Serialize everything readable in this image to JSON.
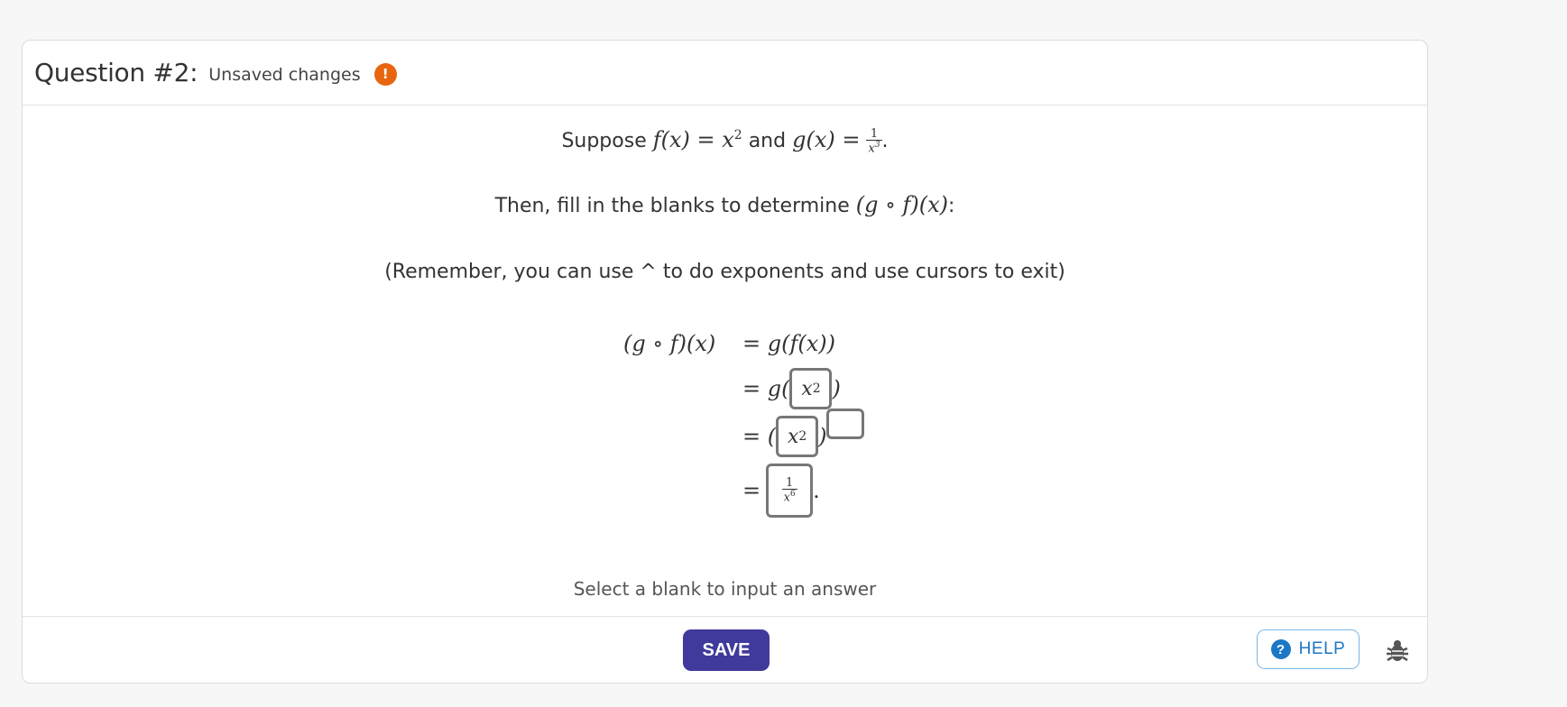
{
  "header": {
    "title": "Question #2:",
    "status": "Unsaved changes",
    "warning_icon": "exclamation-circle-icon",
    "warning_symbol": "!"
  },
  "problem": {
    "intro_prefix": "Suppose",
    "f_def": "f(x) = x",
    "f_exp": "2",
    "and_word": "and",
    "g_def": "g(x) =",
    "g_frac_num": "1",
    "g_frac_den": "x",
    "g_frac_den_exp": "3",
    "period": ".",
    "instruction_prefix": "Then, fill in the blanks to determine",
    "composition": "(g ∘ f)(x)",
    "instruction_suffix": ":",
    "reminder": "(Remember, you can use ^ to do exponents and use cursors to exit)"
  },
  "derivation": {
    "lhs": "(g ∘ f)(x)",
    "row1": "= g(f(x))",
    "row2_prefix": "= g(",
    "row2_suffix": ")",
    "row3_prefix": "= (",
    "row3_suffix": ")",
    "row4_prefix": "=",
    "row4_suffix": ".",
    "blank1": {
      "base": "x",
      "exp": "2"
    },
    "blank2": {
      "base": "x",
      "exp": "2"
    },
    "blank3": {
      "value": ""
    },
    "blank4": {
      "num": "1",
      "den": "x",
      "den_exp": "6"
    }
  },
  "hint": "Select a blank to input an answer",
  "footer": {
    "save_label": "SAVE",
    "help_label": "HELP",
    "help_symbol": "?",
    "help_icon": "question-circle-icon",
    "bug_icon": "bug-icon"
  },
  "colors": {
    "save_button": "#3f3a9c",
    "help_accent": "#1c78c6",
    "warning": "#e8650f"
  }
}
